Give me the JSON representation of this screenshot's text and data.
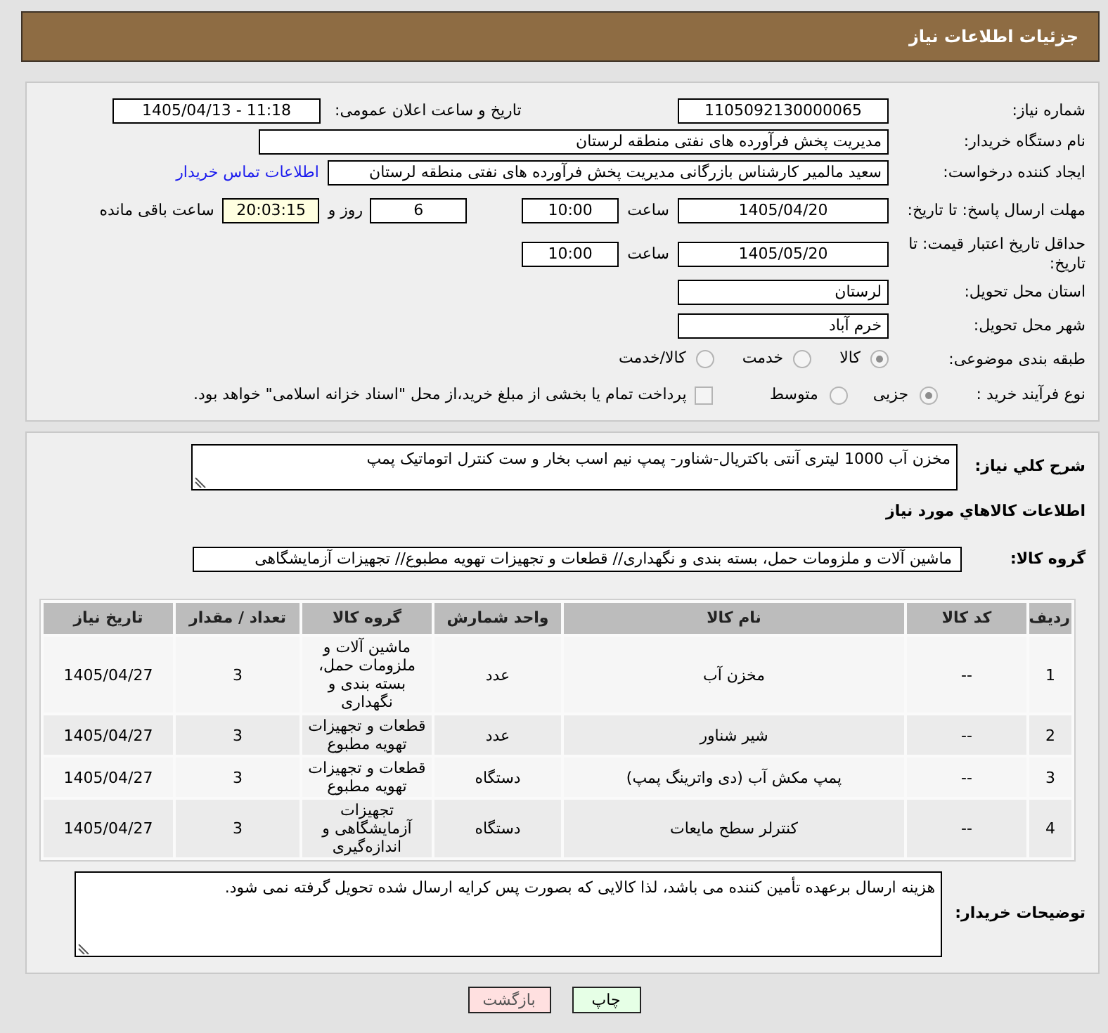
{
  "header": {
    "title": "جزئیات اطلاعات نیاز"
  },
  "need": {
    "number": {
      "label": "شماره نیاز:",
      "value": "1105092130000065"
    },
    "announced": {
      "label": "تاریخ و ساعت اعلان عمومی:",
      "value": "1405/04/13 - 11:18"
    },
    "buyer": {
      "label": "نام دستگاه خریدار:",
      "value": "مدیریت پخش فرآورده های نفتی منطقه لرستان"
    },
    "requester": {
      "label": "ایجاد کننده درخواست:",
      "value": "سعید مالمیر کارشناس بازرگانی مدیریت پخش فرآورده های نفتی منطقه لرستان",
      "contact_link": "اطلاعات تماس خریدار"
    },
    "response_deadline": {
      "label": "مهلت ارسال پاسخ: تا تاریخ:",
      "date": "1405/04/20",
      "time_label": "ساعت",
      "time": "10:00",
      "days": "6",
      "days_label": "روز و",
      "remaining": "20:03:15",
      "remaining_label": "ساعت باقی مانده"
    },
    "price_validity": {
      "label": "حداقل تاریخ اعتبار قیمت: تا تاریخ:",
      "date": "1405/05/20",
      "time_label": "ساعت",
      "time": "10:00"
    },
    "province": {
      "label": "استان محل تحویل:",
      "value": "لرستان"
    },
    "city": {
      "label": "شهر محل تحویل:",
      "value": "خرم آباد"
    },
    "category": {
      "label": "طبقه بندی موضوعی:",
      "options": [
        {
          "label": "کالا",
          "selected": true
        },
        {
          "label": "خدمت",
          "selected": false
        },
        {
          "label": "کالا/خدمت",
          "selected": false
        }
      ]
    },
    "process": {
      "label": "نوع فرآیند خرید :",
      "options": [
        {
          "label": "جزیی",
          "selected": true
        },
        {
          "label": "متوسط",
          "selected": false
        }
      ],
      "treasury": {
        "label": "پرداخت تمام یا بخشی از مبلغ خرید،از محل \"اسناد خزانه اسلامی\" خواهد بود.",
        "checked": false
      }
    }
  },
  "summary": {
    "label": "شرح کلي نیاز:",
    "value": "مخزن آب 1000 لیتری آنتی باکتریال-شناور- پمپ نیم اسب بخار و ست کنترل اتوماتیک پمپ"
  },
  "goods": {
    "title": "اطلاعات کالاهاي مورد نياز",
    "group_label": "گروه کالا:",
    "group_value": "ماشین آلات و ملزومات حمل، بسته بندی و نگهداری// قطعات و تجهیزات تهویه مطبوع// تجهیزات آزمایشگاهی",
    "table": {
      "columns": [
        "ردیف",
        "کد کالا",
        "نام کالا",
        "واحد شمارش",
        "گروه کالا",
        "تعداد / مقدار",
        "تاریخ نیاز"
      ],
      "rows": [
        [
          "1",
          "--",
          "مخزن آب",
          "عدد",
          "ماشین آلات و ملزومات حمل، بسته بندی و نگهداری",
          "3",
          "1405/04/27"
        ],
        [
          "2",
          "--",
          "شیر شناور",
          "عدد",
          "قطعات و تجهیزات تهویه مطبوع",
          "3",
          "1405/04/27"
        ],
        [
          "3",
          "--",
          "پمپ مکش آب (دی واترینگ پمپ)",
          "دستگاه",
          "قطعات و تجهیزات تهویه مطبوع",
          "3",
          "1405/04/27"
        ],
        [
          "4",
          "--",
          "کنترلر سطح مایعات",
          "دستگاه",
          "تجهیزات آزمایشگاهی و اندازه‌گیری",
          "3",
          "1405/04/27"
        ]
      ]
    }
  },
  "buyer_notes": {
    "label": "توضیحات خریدار:",
    "value": "هزینه ارسال برعهده تأمین کننده می باشد، لذا کالایی که بصورت پس کرایه ارسال شده تحویل گرفته نمی شود."
  },
  "buttons": [
    {
      "kind": "print",
      "label": "چاپ"
    },
    {
      "kind": "back",
      "label": "بازگشت"
    }
  ]
}
